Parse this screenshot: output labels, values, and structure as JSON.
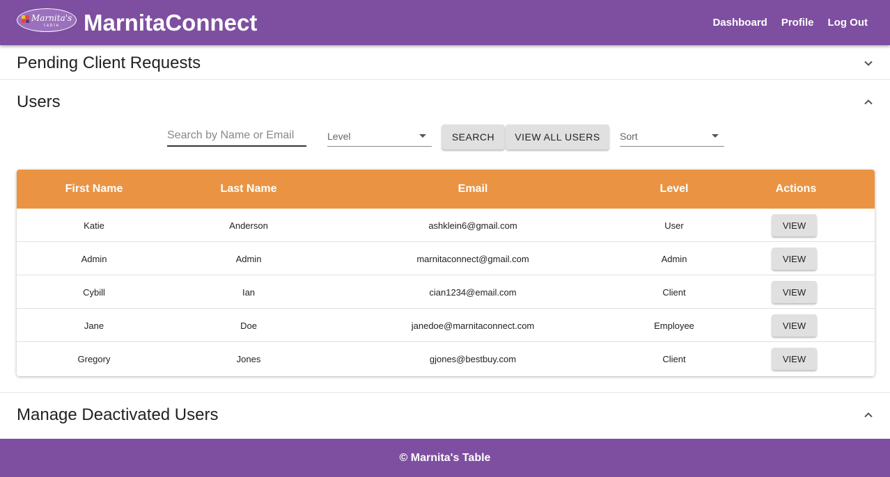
{
  "header": {
    "logo_text": "Marnita's",
    "logo_sub": "table",
    "app_title": "MarnitaConnect",
    "nav": [
      "Dashboard",
      "Profile",
      "Log Out"
    ]
  },
  "sections": {
    "pending": {
      "title": "Pending Client Requests"
    },
    "users": {
      "title": "Users"
    },
    "deactivated": {
      "title": "Manage Deactivated Users"
    }
  },
  "controls": {
    "search_placeholder": "Search by Name or Email",
    "level_label": "Level",
    "search_button": "SEARCH",
    "view_all_button": "VIEW ALL USERS",
    "sort_label": "Sort"
  },
  "table": {
    "columns": [
      "First Name",
      "Last Name",
      "Email",
      "Level",
      "Actions"
    ],
    "rows": [
      {
        "first": "Katie",
        "last": "Anderson",
        "email": "ashklein6@gmail.com",
        "level": "User",
        "action": "VIEW"
      },
      {
        "first": "Admin",
        "last": "Admin",
        "email": "marnitaconnect@gmail.com",
        "level": "Admin",
        "action": "VIEW"
      },
      {
        "first": "Cybill",
        "last": "Ian",
        "email": "cian1234@email.com",
        "level": "Client",
        "action": "VIEW"
      },
      {
        "first": "Jane",
        "last": "Doe",
        "email": "janedoe@marnitaconnect.com",
        "level": "Employee",
        "action": "VIEW"
      },
      {
        "first": "Gregory",
        "last": "Jones",
        "email": "gjones@bestbuy.com",
        "level": "Client",
        "action": "VIEW"
      }
    ]
  },
  "footer": {
    "text": "© Marnita's Table"
  },
  "colors": {
    "header": "#7e4fa0",
    "table_header": "#ea9443"
  },
  "icons": {
    "expand": "chevron-down-icon",
    "collapse": "chevron-up-icon"
  }
}
